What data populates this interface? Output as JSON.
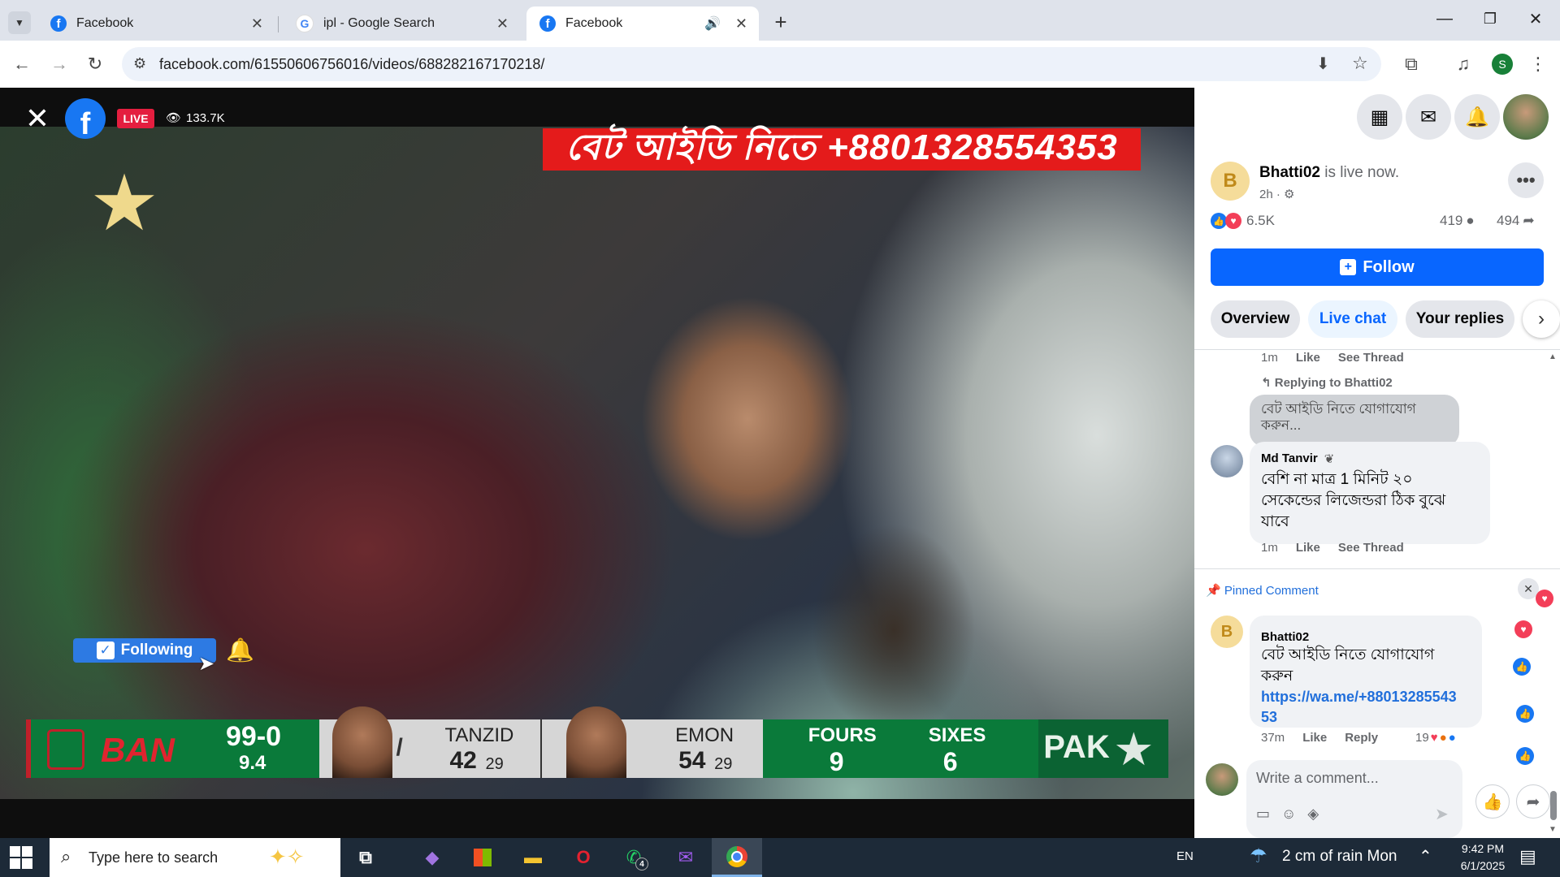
{
  "browser": {
    "tabs": [
      {
        "title": "Facebook",
        "icon": "facebook-icon"
      },
      {
        "title": "ipl - Google Search",
        "icon": "google-icon"
      },
      {
        "title": "Facebook",
        "icon": "facebook-icon",
        "active": true,
        "audio": true
      }
    ],
    "url": "facebook.com/61550606756016/videos/688282167170218/",
    "profile_initial": "S"
  },
  "video": {
    "live_label": "LIVE",
    "viewers": "133.7K",
    "banner_text": "বেট আইডি নিতে +8801328554353",
    "following_label": "Following",
    "scoreboard": {
      "team1": "BAN",
      "score": "99-0",
      "overs": "9.4",
      "batter1_name": "TANZID",
      "batter1_runs": "42",
      "batter1_balls": "29",
      "batter2_name": "EMON",
      "batter2_runs": "54",
      "batter2_balls": "29",
      "fours_label": "FOURS",
      "fours": "9",
      "sixes_label": "SIXES",
      "sixes": "6",
      "team2": "PAK"
    }
  },
  "panel": {
    "page_initial": "B",
    "page_name": "Bhatti02",
    "status": "is live now.",
    "time": "2h ·",
    "reactions_count": "6.5K",
    "comments_count": "419",
    "shares_count": "494",
    "follow_label": "Follow",
    "tabs": [
      "Overview",
      "Live chat",
      "Your replies"
    ],
    "prev_meta": {
      "time": "1m",
      "like": "Like",
      "see_thread": "See Thread"
    },
    "replying_to": "Replying to Bhatti02",
    "quoted_text": "বেট আইডি নিতে যোগাযোগ করুন...",
    "comment": {
      "author": "Md Tanvir",
      "text_line1": "বেশি না মাত্র 1 মিনিট ২০",
      "text_line2": "সেকেন্ডের লিজেন্ডরা ঠিক বুঝে",
      "text_line3": "যাবে",
      "time": "1m",
      "like": "Like",
      "see_thread": "See Thread"
    },
    "pinned_label": "Pinned Comment",
    "pinned": {
      "author_initial": "B",
      "author": "Bhatti02",
      "text_line1": "বেট আইডি নিতে যোগাযোগ",
      "text_line2": "করুন",
      "link_line1": "https://wa.me/+88013285543",
      "link_line2": "53",
      "time": "37m",
      "like": "Like",
      "reply": "Reply",
      "reactions": "19"
    },
    "comment_placeholder": "Write a comment..."
  },
  "taskbar": {
    "search_placeholder": "Type here to search",
    "whatsapp_badge": "4",
    "language": "EN",
    "weather": "2 cm of rain Mon",
    "time": "9:42 PM",
    "date": "6/1/2025"
  },
  "colors": {
    "facebook_blue": "#1877f2",
    "follow_blue": "#0866ff",
    "live_red": "#e41e3f",
    "score_green": "#0a7a3a"
  }
}
